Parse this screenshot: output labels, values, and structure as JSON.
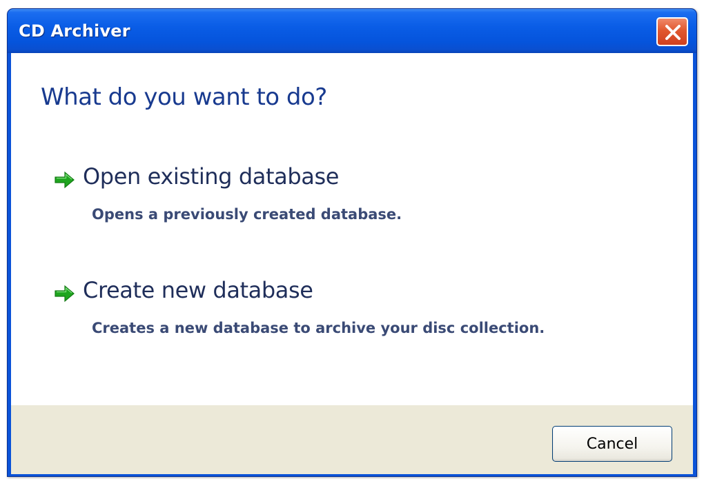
{
  "window": {
    "title": "CD Archiver",
    "close_icon": "close-icon"
  },
  "main": {
    "heading": "What do you want to do?",
    "options": [
      {
        "icon": "green-arrow-icon",
        "title": "Open existing database",
        "description": "Opens a previously created database."
      },
      {
        "icon": "green-arrow-icon",
        "title": "Create new database",
        "description": "Creates a new database to archive your disc collection."
      }
    ]
  },
  "footer": {
    "cancel_label": "Cancel"
  },
  "colors": {
    "titlebar": "#0a5de6",
    "heading": "#183a8f",
    "arrow": "#1fa51f",
    "footer_bg": "#ece9d8",
    "close_button": "#e1582f"
  }
}
